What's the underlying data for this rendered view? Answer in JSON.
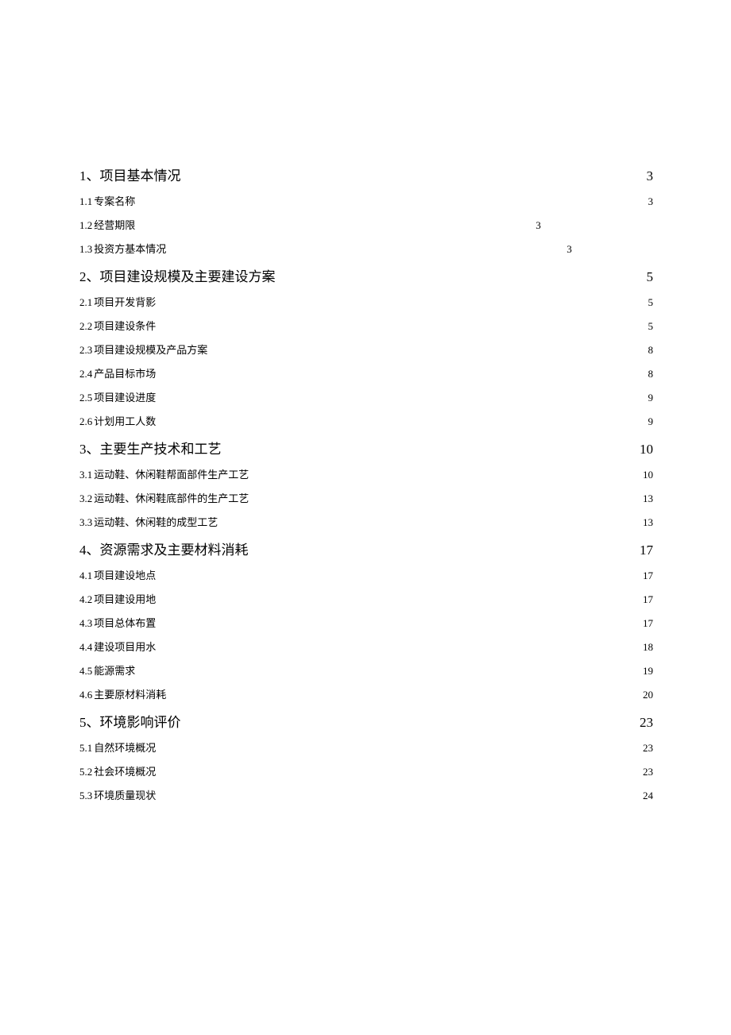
{
  "toc": [
    {
      "type": "section",
      "num": "1、",
      "title": "项目基本情况",
      "page": "3",
      "gap": true,
      "short": false
    },
    {
      "type": "sub",
      "num": "1.1",
      "title": "专案名称",
      "page": "3",
      "gap": true,
      "short": false
    },
    {
      "type": "sub",
      "num": "1.2",
      "title": "经营期限",
      "page": "3",
      "gap": false,
      "short": true
    },
    {
      "type": "sub",
      "num": "1.3",
      "title": "投资方基本情况",
      "page": "3",
      "gap": false,
      "short": true
    },
    {
      "type": "section",
      "num": "2、",
      "title": "项目建设规模及主要建设方案 ",
      "page": "5",
      "gap": true,
      "short": false
    },
    {
      "type": "sub",
      "num": "2.1",
      "title": "项目开发背影",
      "page": "5",
      "gap": true,
      "short": false
    },
    {
      "type": "sub",
      "num": "2.2",
      "title": "项目建设条件",
      "page": "5",
      "gap": false,
      "short": false
    },
    {
      "type": "sub",
      "num": "2.3",
      "title": "项目建设规模及产品方案",
      "page": "8",
      "gap": false,
      "short": false
    },
    {
      "type": "sub",
      "num": "2.4",
      "title": "产品目标市场",
      "page": "8",
      "gap": false,
      "short": false
    },
    {
      "type": "sub",
      "num": "2.5",
      "title": "项目建设进度",
      "page": "9",
      "gap": false,
      "short": false
    },
    {
      "type": "sub",
      "num": "2.6",
      "title": "计划用工人数",
      "page": "9",
      "gap": false,
      "short": false
    },
    {
      "type": "section",
      "num": "3、",
      "title": "主要生产技术和工艺",
      "page": "10",
      "gap": true,
      "short": false
    },
    {
      "type": "sub",
      "num": "3.1",
      "title": "运动鞋、休闲鞋帮面部件生产工艺",
      "page": "10",
      "gap": true,
      "short": false
    },
    {
      "type": "sub",
      "num": "3.2",
      "title": "运动鞋、休闲鞋底部件的生产工艺",
      "page": "13",
      "gap": false,
      "short": false
    },
    {
      "type": "sub",
      "num": "3.3",
      "title": "运动鞋、休闲鞋的成型工艺",
      "page": "13",
      "gap": true,
      "short": false
    },
    {
      "type": "section",
      "num": "4、",
      "title": "资源需求及主要材料消耗",
      "page": "17",
      "gap": true,
      "short": false
    },
    {
      "type": "sub",
      "num": "4.1",
      "title": "项目建设地点",
      "page": "17",
      "gap": true,
      "short": false
    },
    {
      "type": "sub",
      "num": "4.2",
      "title": "项目建设用地",
      "page": "17",
      "gap": true,
      "short": false
    },
    {
      "type": "sub",
      "num": "4.3",
      "title": "项目总体布置",
      "page": "17",
      "gap": true,
      "short": false
    },
    {
      "type": "sub",
      "num": "4.4",
      "title": "建设项目用水",
      "page": "18",
      "gap": false,
      "short": false
    },
    {
      "type": "sub",
      "num": "4.5",
      "title": "能源需求",
      "page": "19",
      "gap": true,
      "short": false
    },
    {
      "type": "sub",
      "num": "4.6",
      "title": "主要原材料消耗",
      "page": "20",
      "gap": false,
      "short": false
    },
    {
      "type": "section",
      "num": "5、",
      "title": "环境影响评价",
      "page": "23",
      "gap": true,
      "short": false
    },
    {
      "type": "sub",
      "num": "5.1",
      "title": "自然环境概况",
      "page": "23",
      "gap": false,
      "short": false
    },
    {
      "type": "sub",
      "num": "5.2",
      "title": "社会环境概况",
      "page": "23",
      "gap": false,
      "short": false
    },
    {
      "type": "sub",
      "num": "5.3",
      "title": "环境质量现状",
      "page": "24",
      "gap": true,
      "short": false
    }
  ]
}
